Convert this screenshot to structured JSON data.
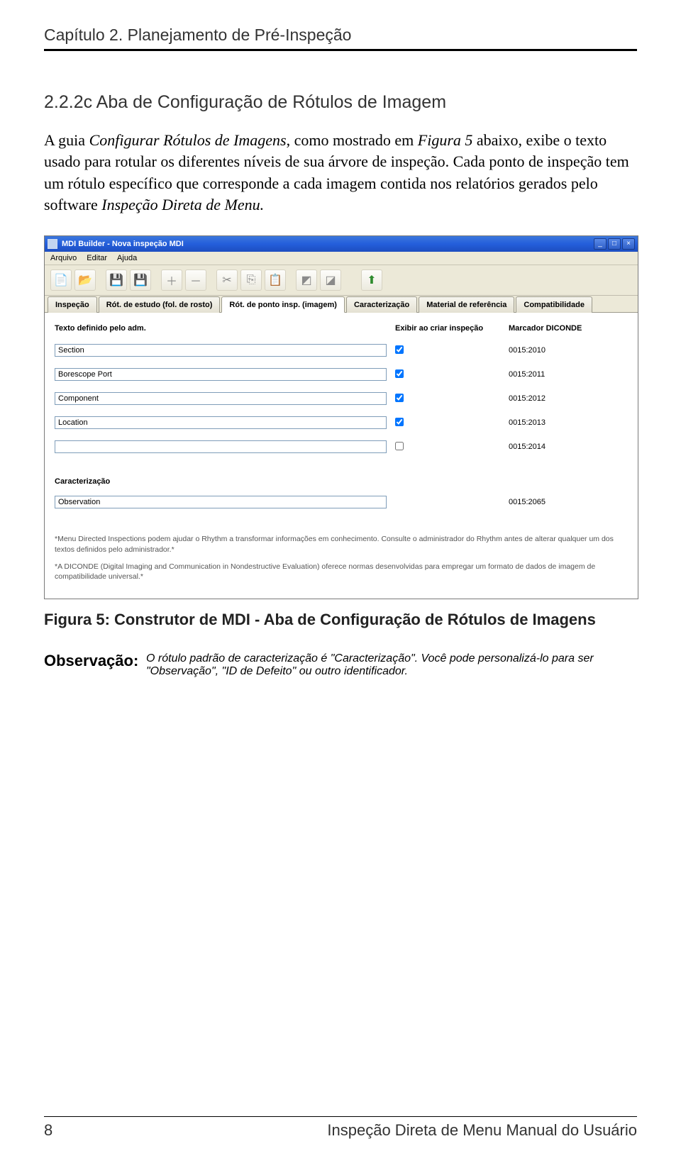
{
  "chapter_header": "Capítulo 2.  Planejamento de Pré-Inspeção",
  "section_heading": "2.2.2c   Aba de Configuração de Rótulos de Imagem",
  "para_lead": "A guia ",
  "para_italic1": "Configurar Rótulos de Imagens",
  "para_mid": ", como mostrado em ",
  "para_italic2": "Figura 5",
  "para_rest": " abaixo, exibe o texto usado para rotular os diferentes níveis de sua árvore de inspeção. Cada ponto de inspeção tem um rótulo específico que corresponde a cada imagem contida nos relatórios gerados pelo software ",
  "para_italic3": "Inspeção Direta de Menu.",
  "app": {
    "title": "MDI Builder  - Nova inspeção MDI",
    "menu": {
      "file": "Arquivo",
      "edit": "Editar",
      "help": "Ajuda"
    },
    "tabs": {
      "t1": "Inspeção",
      "t2": "Rót. de estudo (fol. de rosto)",
      "t3": "Rót. de ponto insp. (imagem)",
      "t4": "Caracterização",
      "t5": "Material de referência",
      "t6": "Compatibilidade"
    },
    "headers": {
      "c1": "Texto definido pelo adm.",
      "c2": "Exibir ao criar inspeção",
      "c3": "Marcador DICONDE"
    },
    "rows": [
      {
        "text": "Section",
        "diconde": "0015:2010"
      },
      {
        "text": "Borescope Port",
        "diconde": "0015:2011"
      },
      {
        "text": "Component",
        "diconde": "0015:2012"
      },
      {
        "text": "Location",
        "diconde": "0015:2013"
      },
      {
        "text": "",
        "diconde": "0015:2014"
      }
    ],
    "char_heading": "Caracterização",
    "char_row": {
      "text": "Observation",
      "diconde": "0015:2065"
    },
    "footnote1": "*Menu Directed Inspections podem ajudar o Rhythm a transformar informações em conhecimento. Consulte o administrador do Rhythm antes de alterar qualquer um dos textos definidos pelo administrador.*",
    "footnote2": "*A DICONDE (Digital Imaging and Communication in Nondestructive Evaluation) oferece normas desenvolvidas para empregar um formato de dados de imagem de compatibilidade universal.*"
  },
  "figure_caption": "Figura 5: Construtor de MDI - Aba de Configuração de Rótulos de Imagens",
  "obs": {
    "label": "Observação:",
    "body": "O rótulo padrão de caracterização é \"Caracterização\". Você pode personalizá-lo para ser \"Observação\", \"ID de Defeito\" ou outro identificador."
  },
  "footer": {
    "page": "8",
    "doc": "Inspeção Direta de Menu Manual do Usuário"
  }
}
